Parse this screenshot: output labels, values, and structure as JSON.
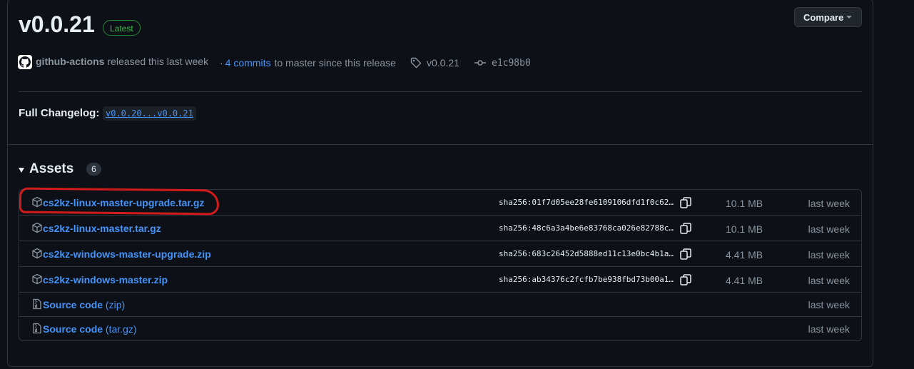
{
  "release": {
    "version": "v0.0.21",
    "latest_badge": "Latest",
    "compare_label": "Compare",
    "author": "github-actions",
    "released_text": "released this last week",
    "commits_prefix": "·",
    "commits_link": "4 commits",
    "commits_suffix": "to master since this release",
    "tag": "v0.0.21",
    "commit_hash": "e1c98b0",
    "changelog_label": "Full Changelog:",
    "changelog_range": "v0.0.20...v0.0.21"
  },
  "assets": {
    "title": "Assets",
    "count": "6",
    "items": [
      {
        "name": "cs2kz-linux-master-upgrade.tar.gz",
        "sha": "sha256:01f7d05ee28fe6109106dfd1f0c62…",
        "size": "10.1 MB",
        "date": "last week",
        "icon": "package-icon"
      },
      {
        "name": "cs2kz-linux-master.tar.gz",
        "sha": "sha256:48c6a3a4be6e83768ca026e82788c…",
        "size": "10.1 MB",
        "date": "last week",
        "icon": "package-icon"
      },
      {
        "name": "cs2kz-windows-master-upgrade.zip",
        "sha": "sha256:683c26452d5888ed11c13e0bc4b1a…",
        "size": "4.41 MB",
        "date": "last week",
        "icon": "package-icon"
      },
      {
        "name": "cs2kz-windows-master.zip",
        "sha": "sha256:ab34376c2fcfb7be938fbd73b00a1…",
        "size": "4.41 MB",
        "date": "last week",
        "icon": "package-icon"
      },
      {
        "name": "Source code",
        "suffix": "(zip)",
        "date": "last week",
        "icon": "file-zip-icon"
      },
      {
        "name": "Source code",
        "suffix": "(tar.gz)",
        "date": "last week",
        "icon": "file-zip-icon"
      }
    ]
  },
  "colors": {
    "background": "#0d1117",
    "link": "#4493f8",
    "latest_green": "#3fb950",
    "annotation_red": "#d11a1a"
  }
}
